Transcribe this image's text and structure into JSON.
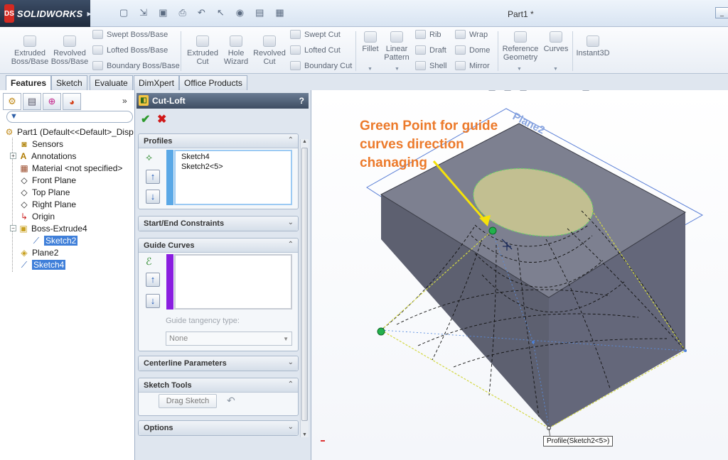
{
  "app": {
    "brand": "SOLIDWORKS",
    "logo_badge": "DS",
    "document_title": "Part1 *"
  },
  "quick_access": [
    "new-icon",
    "open-icon",
    "save-icon",
    "print-icon",
    "undo-icon",
    "select-icon",
    "rebuild-icon",
    "file-properties-icon",
    "options-icon"
  ],
  "ribbon": {
    "extruded_boss": "Extruded\nBoss/Base",
    "revolved_boss": "Revolved\nBoss/Base",
    "swept_boss": "Swept Boss/Base",
    "lofted_boss": "Lofted Boss/Base",
    "boundary_boss": "Boundary Boss/Base",
    "extruded_cut": "Extruded\nCut",
    "hole_wizard": "Hole\nWizard",
    "revolved_cut": "Revolved\nCut",
    "swept_cut": "Swept Cut",
    "lofted_cut": "Lofted Cut",
    "boundary_cut": "Boundary Cut",
    "fillet": "Fillet",
    "linear_pattern": "Linear\nPattern",
    "rib": "Rib",
    "draft": "Draft",
    "shell": "Shell",
    "wrap": "Wrap",
    "dome": "Dome",
    "mirror": "Mirror",
    "reference_geometry": "Reference\nGeometry",
    "curves": "Curves",
    "instant3d": "Instant3D"
  },
  "tabs": [
    "Features",
    "Sketch",
    "Evaluate",
    "DimXpert",
    "Office Products"
  ],
  "active_tab": "Features",
  "feature_tree": {
    "part": "Part1  (Default<<Default>_Disp",
    "items": [
      {
        "label": "Sensors",
        "icon": "sensor-icon"
      },
      {
        "label": "Annotations",
        "icon": "annotations-icon"
      },
      {
        "label": "Material <not specified>",
        "icon": "material-icon"
      },
      {
        "label": "Front Plane",
        "icon": "plane-icon"
      },
      {
        "label": "Top Plane",
        "icon": "plane-icon"
      },
      {
        "label": "Right Plane",
        "icon": "plane-icon"
      },
      {
        "label": "Origin",
        "icon": "origin-icon"
      },
      {
        "label": "Boss-Extrude4",
        "icon": "extrude-icon"
      },
      {
        "label": "Sketch2",
        "icon": "sketch-icon"
      },
      {
        "label": "Plane2",
        "icon": "plane-icon"
      },
      {
        "label": "Sketch4",
        "icon": "sketch-icon"
      }
    ]
  },
  "property_manager": {
    "title": "Cut-Loft",
    "help": "?",
    "profiles": {
      "header": "Profiles",
      "items": [
        "Sketch4",
        "Sketch2<5>"
      ]
    },
    "start_end_constraints": "Start/End Constraints",
    "guide_curves": {
      "header": "Guide Curves",
      "tangency_label": "Guide tangency type:",
      "tangency_value": "None"
    },
    "centerline_parameters": "Centerline Parameters",
    "sketch_tools": {
      "header": "Sketch Tools",
      "drag_sketch": "Drag Sketch"
    },
    "options": "Options"
  },
  "graphics": {
    "plane_label": "Plane2",
    "annotation": "Green Point for guide curves direction chanaging",
    "callout": "Profile(Sketch2<5>)",
    "colors": {
      "annotation": "#ec7a2b",
      "arrow": "#f5e20a",
      "green_point": "#22b14c",
      "plane": "#5a7fd6",
      "selection_fill": "#d9d492"
    }
  }
}
